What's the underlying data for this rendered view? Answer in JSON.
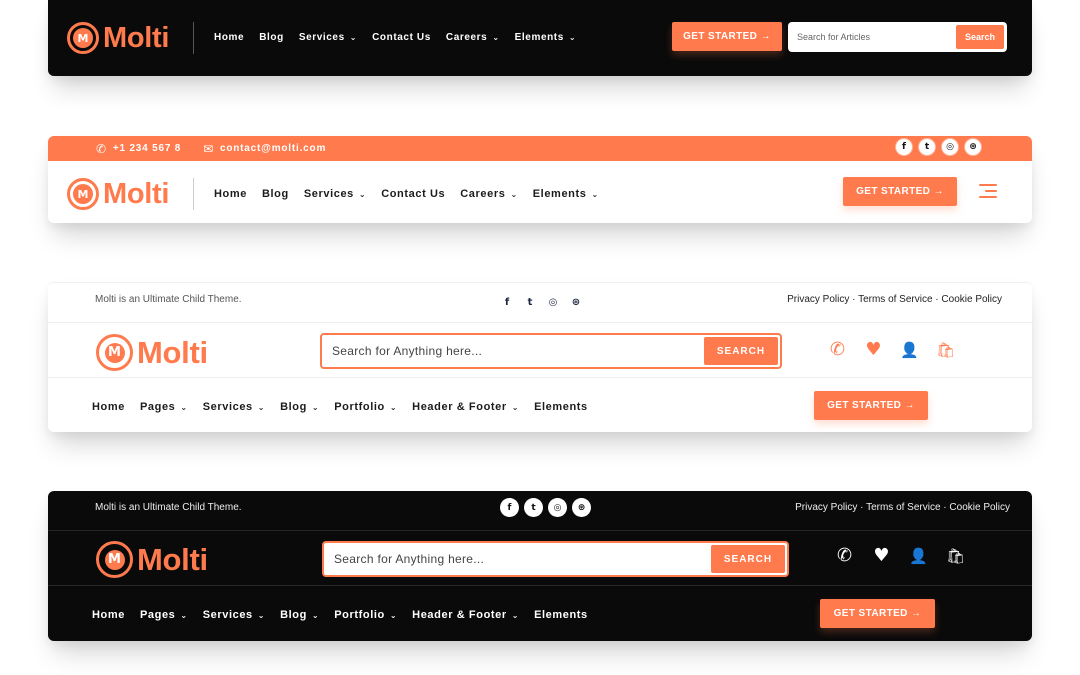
{
  "brand": {
    "name": "Molti",
    "mark": "M",
    "accent": "#ff7a4d"
  },
  "header1": {
    "nav": [
      {
        "label": "Home",
        "dropdown": false
      },
      {
        "label": "Blog",
        "dropdown": false
      },
      {
        "label": "Services",
        "dropdown": true
      },
      {
        "label": "Contact Us",
        "dropdown": false
      },
      {
        "label": "Careers",
        "dropdown": true
      },
      {
        "label": "Elements",
        "dropdown": true
      }
    ],
    "cta": "GET STARTED →",
    "search_placeholder": "Search for Articles",
    "search_button": "Search"
  },
  "header2": {
    "phone": "+1 234 567 8",
    "email": "contact@molti.com",
    "socials": [
      "f",
      "t",
      "◎",
      "⊛"
    ],
    "nav": [
      {
        "label": "Home",
        "dropdown": false
      },
      {
        "label": "Blog",
        "dropdown": false
      },
      {
        "label": "Services",
        "dropdown": true
      },
      {
        "label": "Contact Us",
        "dropdown": false
      },
      {
        "label": "Careers",
        "dropdown": true
      },
      {
        "label": "Elements",
        "dropdown": true
      }
    ],
    "cta": "GET STARTED →"
  },
  "header3": {
    "tagline": "Molti is an Ultimate Child Theme.",
    "policies": "Privacy Policy · Terms of Service · Cookie Policy",
    "search_placeholder": "Search for Anything here...",
    "search_button": "SEARCH",
    "nav": [
      {
        "label": "Home",
        "dropdown": false
      },
      {
        "label": "Pages",
        "dropdown": true
      },
      {
        "label": "Services",
        "dropdown": true
      },
      {
        "label": "Blog",
        "dropdown": true
      },
      {
        "label": "Portfolio",
        "dropdown": true
      },
      {
        "label": "Header & Footer",
        "dropdown": true
      },
      {
        "label": "Elements",
        "dropdown": false
      }
    ],
    "cta": "GET STARTED →"
  },
  "header4": {
    "tagline": "Molti is an Ultimate Child Theme.",
    "policies": "Privacy Policy · Terms of Service · Cookie Policy",
    "search_placeholder": "Search for Anything here...",
    "search_button": "SEARCH",
    "nav": [
      {
        "label": "Home",
        "dropdown": false
      },
      {
        "label": "Pages",
        "dropdown": true
      },
      {
        "label": "Services",
        "dropdown": true
      },
      {
        "label": "Blog",
        "dropdown": true
      },
      {
        "label": "Portfolio",
        "dropdown": true
      },
      {
        "label": "Header & Footer",
        "dropdown": true
      },
      {
        "label": "Elements",
        "dropdown": false
      }
    ],
    "cta": "GET STARTED →"
  },
  "icons": {
    "chevron": "⌄",
    "phone": "✆",
    "mail": "✉",
    "heart": "♥",
    "user": "👤",
    "bag": "🛍"
  }
}
